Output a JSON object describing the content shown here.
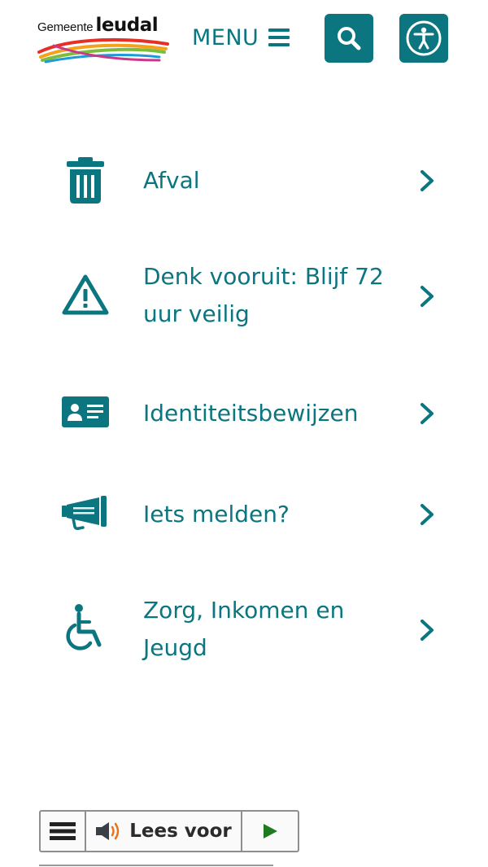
{
  "header": {
    "logo": {
      "prefix": "Gemeente",
      "name": "leudal"
    },
    "menu_label": "MENU",
    "search_icon": "search-icon",
    "accessibility_icon": "accessibility-icon"
  },
  "colors": {
    "accent": "#0b7580",
    "text_dark": "#2b2b2b",
    "play_green": "#1e7a1e",
    "speaker_orange": "#e8731f"
  },
  "items": [
    {
      "label": "Afval",
      "icon": "trash-icon"
    },
    {
      "label": "Denk vooruit: Blijf 72 uur veilig",
      "icon": "warning-triangle-icon"
    },
    {
      "label": "Identiteitsbewijzen",
      "icon": "id-card-icon"
    },
    {
      "label": "Iets melden?",
      "icon": "megaphone-icon"
    },
    {
      "label": "Zorg, Inkomen en Jeugd",
      "icon": "wheelchair-icon"
    }
  ],
  "read_aloud": {
    "label": "Lees voor",
    "menu_icon": "hamburger-icon",
    "speaker_icon": "speaker-icon",
    "play_icon": "play-icon"
  }
}
